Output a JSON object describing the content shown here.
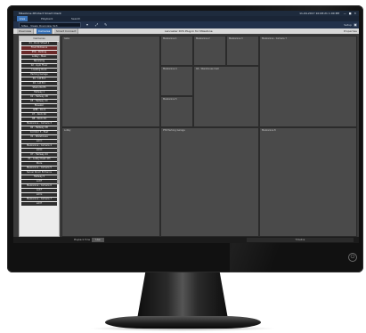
{
  "app": {
    "title": "Milestone XProtect Smart Client",
    "datetime": "11-04-2017  10:08:21  1:00 PM",
    "window_controls": "— ■ ✕"
  },
  "menu": {
    "tabs": [
      "Live",
      "Playback",
      "Search"
    ],
    "active_tab": 0
  },
  "toolbar": {
    "view_selector": "Sites  ·  Views  Overview 3x3",
    "setup_label": "Setup"
  },
  "subtabs": {
    "tabs": [
      "Overview",
      "Cameras",
      "Smart Connect"
    ],
    "active_tab": 1,
    "center_text": "Lancaster DVS Plug-In for Milestone",
    "right_text": "Properties"
  },
  "camera_panel": {
    "header": "Cameras",
    "items": [
      "01 - Dock Street 1",
      "Front Entrance",
      "PTZ - Parking",
      "Lobby - Main",
      "Receiving",
      "02 - Gym Floor",
      "Loading Dock",
      "Parking Garage",
      "01 - Lot B A",
      "04 - Lot B C",
      "Stairs North",
      "Hallway 1",
      "02 - Hallway 2B",
      "05 - Hallway 2C",
      "Elevator",
      "AMB - Dock",
      "07 - Dock 40",
      "08 - Dock 44",
      "Mezzanine - Camera 3",
      "02 - Hallway 2D",
      "Corridor 3 - East",
      "01 - Warehouse",
      "Lot C",
      "Mezzanine - Camera 4",
      "Lot D",
      "07 - Hallway 44",
      "01 - Lobby Desk 4th",
      "Store",
      "Mezzanine - Camera 5",
      "Server Room Entrance",
      "Hallway 5",
      "Lot E",
      "Mezzanine - Camera 6",
      "Lot F",
      "Lot G",
      "Mezzanine - Camera 7",
      "Lot H"
    ],
    "highlighted": [
      1,
      2
    ]
  },
  "video_grid": {
    "cells": [
      "Gate",
      "Mezzanine 1",
      "Mezzanine 2",
      "Mezzanine 3",
      "Mezzanine - Camera 7",
      "Mezzanine 4",
      "04 - Warehouse Cam",
      "Mezzanine 5",
      "Lobby",
      "PTZ Parking Garage",
      "Mezzanine 8"
    ]
  },
  "bottombar": {
    "label": "Playback Time",
    "button": "Live",
    "right_text": "Timeline"
  }
}
